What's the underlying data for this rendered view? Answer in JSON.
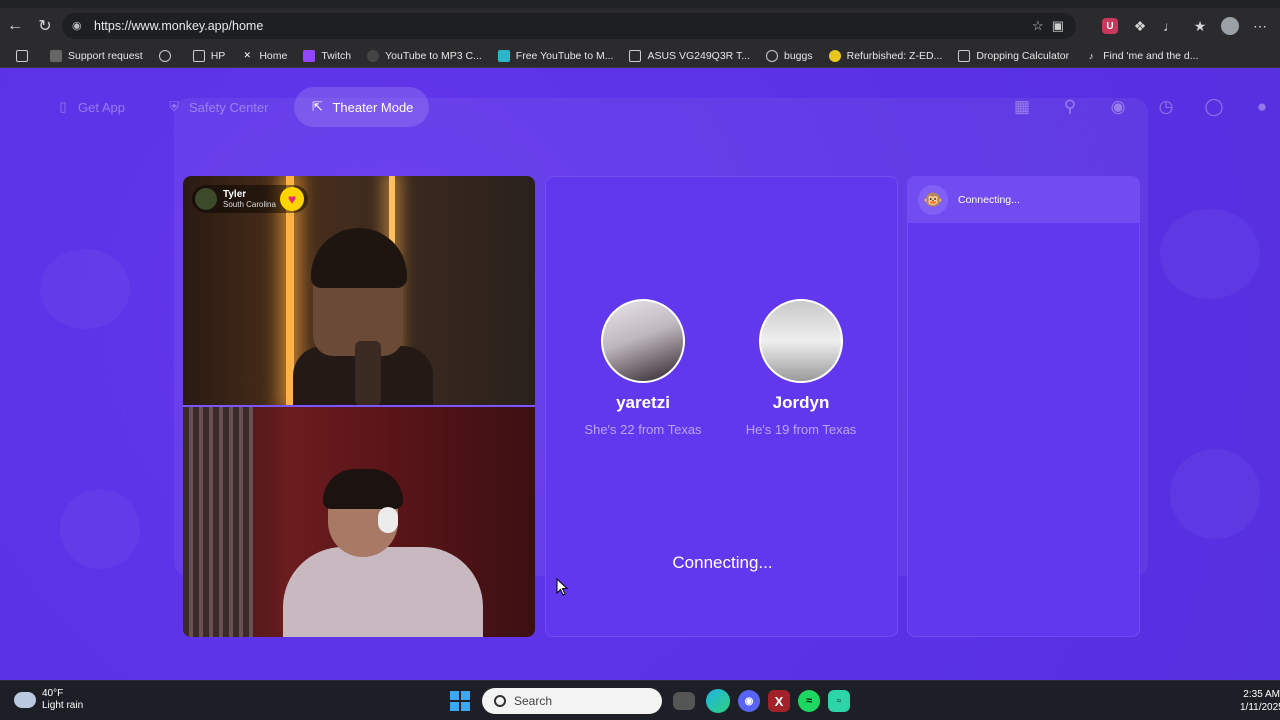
{
  "browser": {
    "url": "https://www.monkey.app/home",
    "bookmarks": [
      {
        "label": "Support request",
        "icon": "support-icon"
      },
      {
        "label": "",
        "icon": "globe-icon"
      },
      {
        "label": "HP",
        "icon": "folder-icon"
      },
      {
        "label": "Home",
        "icon": "x-icon"
      },
      {
        "label": "Twitch",
        "icon": "twitch-icon"
      },
      {
        "label": "YouTube to MP3 C...",
        "icon": "youtube-icon"
      },
      {
        "label": "Free YouTube to M...",
        "icon": "ytm-icon"
      },
      {
        "label": "ASUS VG249Q3R T...",
        "icon": "asus-icon"
      },
      {
        "label": "buggs",
        "icon": "globe-icon"
      },
      {
        "label": "Refurbished: Z-ED...",
        "icon": "ebay-icon"
      },
      {
        "label": "Dropping Calculator",
        "icon": "calculator-icon"
      },
      {
        "label": "Find 'me and the d...",
        "icon": "tiktok-icon"
      }
    ]
  },
  "nav": {
    "get_app": "Get App",
    "safety_center": "Safety Center",
    "theater_mode": "Theater Mode"
  },
  "video": {
    "user_name": "Tyler",
    "user_location": "South Carolina"
  },
  "matches": [
    {
      "name": "yaretzi",
      "desc": "She's 22 from Texas"
    },
    {
      "name": "Jordyn",
      "desc": "He's 19 from Texas"
    }
  ],
  "status": {
    "connecting_main": "Connecting...",
    "connecting_chat": "Connecting..."
  },
  "taskbar": {
    "temperature": "40°F",
    "weather": "Light rain",
    "search_placeholder": "Search",
    "time": "2:35 AM",
    "date": "1/11/2025"
  },
  "colors": {
    "accent": "#5b32e6",
    "panel": "#6238ef",
    "heart": "#ffd400"
  }
}
